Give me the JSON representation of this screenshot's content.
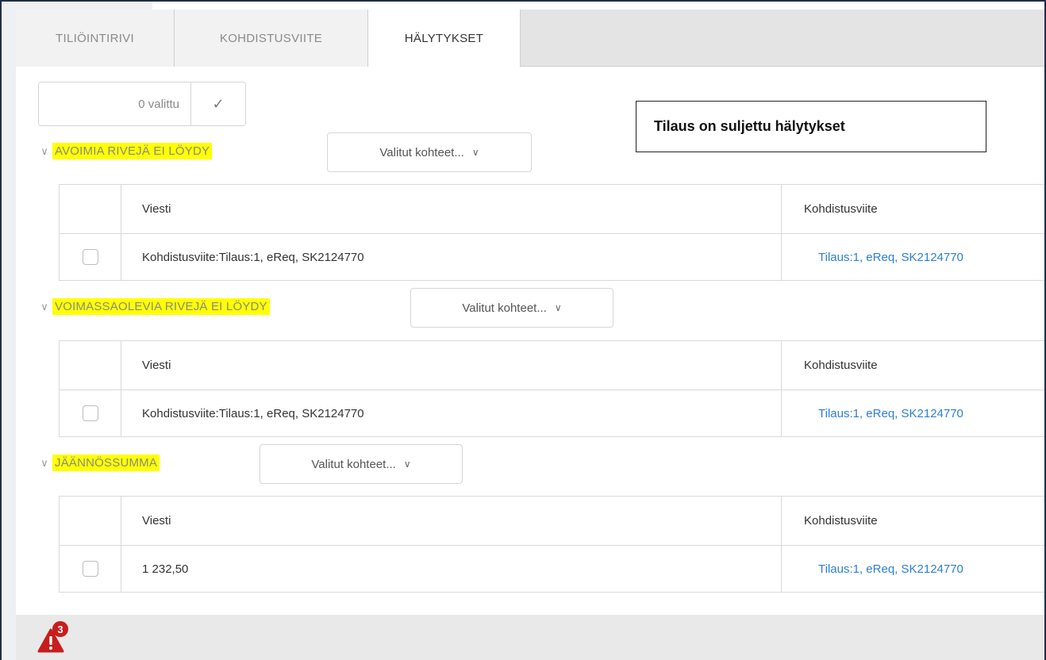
{
  "tabs": [
    {
      "label": "TILIÖINTIRIVI",
      "active": false
    },
    {
      "label": "KOHDISTUSVIITE",
      "active": false
    },
    {
      "label": "HÄLYTYKSET",
      "active": true
    }
  ],
  "selection": {
    "count_label": "0 valittu",
    "confirm_icon": "check-icon"
  },
  "callout": {
    "text": "Tilaus on suljettu hälytykset"
  },
  "groups": [
    {
      "title": "AVOIMIA RIVEJÄ EI LÖYDY",
      "dropdown": "Valitut kohteet...",
      "columns": [
        "Viesti",
        "Kohdistusviite"
      ],
      "rows": [
        {
          "message": "Kohdistusviite:Tilaus:1, eReq, SK2124770",
          "reference": "Tilaus:1, eReq, SK2124770"
        }
      ]
    },
    {
      "title": "VOIMASSAOLEVIA RIVEJÄ EI LÖYDY",
      "dropdown": "Valitut kohteet...",
      "columns": [
        "Viesti",
        "Kohdistusviite"
      ],
      "rows": [
        {
          "message": "Kohdistusviite:Tilaus:1, eReq, SK2124770",
          "reference": "Tilaus:1, eReq, SK2124770"
        }
      ]
    },
    {
      "title": "JÄÄNNÖSSUMMA",
      "dropdown": "Valitut kohteet...",
      "columns": [
        "Viesti",
        "Kohdistusviite"
      ],
      "rows": [
        {
          "message": "1 232,50",
          "reference": "Tilaus:1, eReq, SK2124770"
        }
      ]
    }
  ],
  "footer": {
    "alert_count": "3",
    "alert_icon": "warning-icon"
  },
  "colors": {
    "highlight": "#ffff00",
    "link": "#2b7fd4",
    "alert": "#c81d1d"
  }
}
